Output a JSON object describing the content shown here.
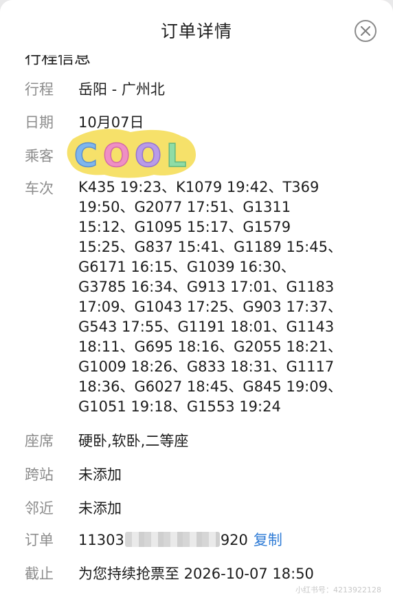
{
  "header": {
    "title": "订单详情",
    "close_icon": "close-icon"
  },
  "section": {
    "title": "行程信息"
  },
  "rows": {
    "route": {
      "label": "行程",
      "value": "岳阳 - 广州北"
    },
    "date": {
      "label": "日期",
      "value": "10月07日"
    },
    "passenger": {
      "label": "乘客",
      "value": ""
    },
    "trains": {
      "label": "车次",
      "lines": [
        "K435 19:23、K1079 19:42、T369",
        "19:50、G2077 17:51、G1311",
        "15:12、G1095 15:17、G1579",
        "15:25、G837 15:41、G1189 15:45、",
        "G6171 16:15、G1039 16:30、",
        "G3785 16:34、G913 17:01、G1183",
        "17:09、G1043 17:25、G903 17:37、",
        "G543 17:55、G1191 18:01、G1143",
        "18:11、G695 18:16、G2055 18:21、",
        "G1009 18:26、G833 18:31、G1117",
        "18:36、G6027 18:45、G845 19:09、",
        "G1051 19:18、G1553 19:24"
      ]
    },
    "seat": {
      "label": "座席",
      "value": "硬卧,软卧,二等座"
    },
    "cross_station": {
      "label": "跨站",
      "value": "未添加"
    },
    "nearby": {
      "label": "邻近",
      "value": "未添加"
    },
    "order": {
      "label": "订单",
      "prefix": "11303",
      "suffix": "920",
      "copy_label": "复制"
    },
    "deadline": {
      "label": "截止",
      "value": "为您持续抢票至 2026-10-07 18:50"
    }
  },
  "sticker": {
    "text": "COOL"
  },
  "watermark": "小红书号：4213922128",
  "colors": {
    "accent_link": "#2e7bd6",
    "label_gray": "#8c8c8c",
    "text": "#1c1c1c"
  }
}
